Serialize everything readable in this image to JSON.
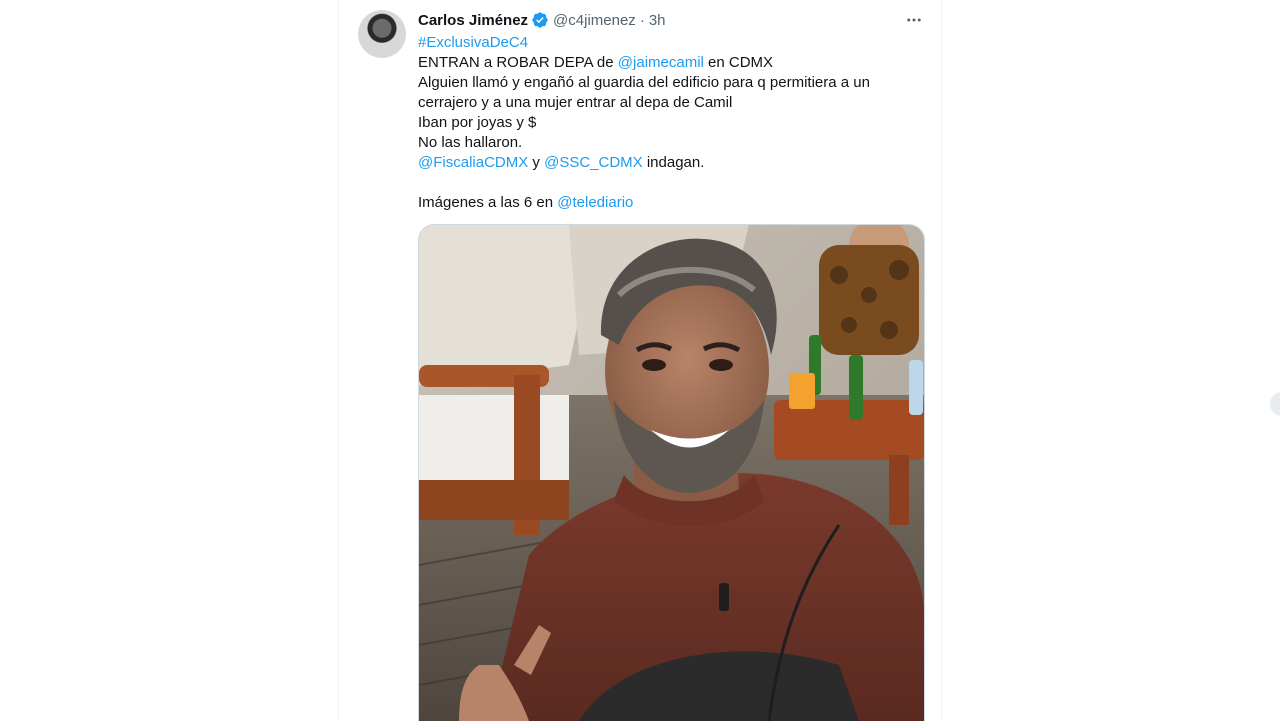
{
  "tweet": {
    "author": {
      "display_name": "Carlos Jiménez",
      "handle": "@c4jimenez",
      "verified": true,
      "avatar_icon": "profile-avatar"
    },
    "separator": "·",
    "time": "3h",
    "more_icon": "more-options-icon",
    "text": {
      "hashtag": "#ExclusivaDeC4",
      "line2_pre": "ENTRAN a ROBAR DEPA de ",
      "line2_mention": "@jaimecamil",
      "line2_post": " en CDMX",
      "line3": "Alguien llamó y engañó al guardia del edificio para q permitiera a un",
      "line4": "cerrajero y a una mujer entrar al depa de Camil",
      "line5": "Iban por joyas y $",
      "line6": "No las hallaron.",
      "line7_mention1": "@FiscaliaCDMX",
      "line7_mid": " y ",
      "line7_mention2": "@SSC_CDMX",
      "line7_post": " indagan.",
      "line9_pre": "Imágenes a las 6 en ",
      "line9_mention": "@telediario"
    },
    "media": {
      "type": "photo"
    }
  },
  "colors": {
    "text": "#0f1419",
    "secondary": "#536471",
    "link": "#1d9bf0",
    "border": "#cfd9de"
  }
}
